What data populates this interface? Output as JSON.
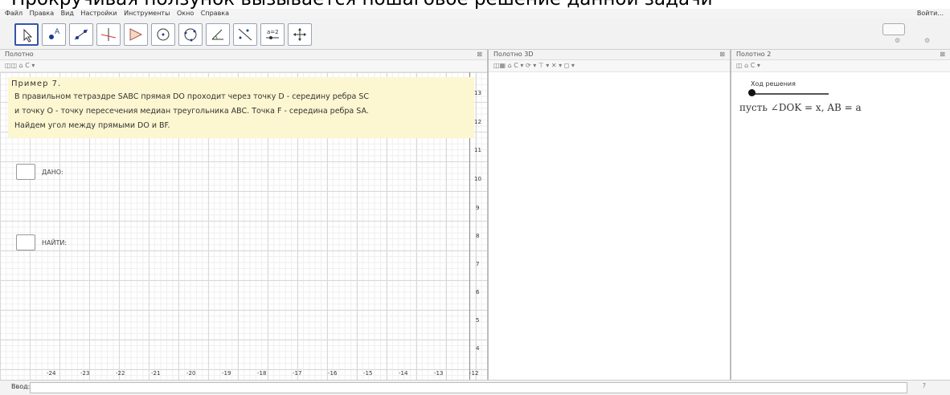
{
  "caption": "Прокручивая ползунок вызывается пошаговое решение данной задачи",
  "menu": {
    "items": [
      "Файл",
      "Правка",
      "Вид",
      "Настройки",
      "Инструменты",
      "Окно",
      "Справка"
    ],
    "login": "Войти..."
  },
  "panels": {
    "drawing": {
      "title": "Полотно"
    },
    "view3d": {
      "title": "Полотно 3D"
    },
    "drawing2": {
      "title": "Полотно 2"
    }
  },
  "textbox": {
    "title": "Пример 7.",
    "line1": "В правильном тетраэдре SABC прямая DO проходит через точку D - середину ребра SC",
    "line2": "и точку O - точку пересечения медиан треугольника ABC. Точка F - середина ребра SA.",
    "line3": "Найдем угол между прямыми DO и BF."
  },
  "checkboxes": {
    "given": "ДАНО:",
    "find": "НАЙТИ:"
  },
  "axes": {
    "x": [
      "-24",
      "-23",
      "-22",
      "-21",
      "-20",
      "-19",
      "-18",
      "-17",
      "-16",
      "-15",
      "-14",
      "-13",
      "-12"
    ],
    "y": [
      "13",
      "12",
      "11",
      "10",
      "9",
      "8",
      "7",
      "6",
      "5",
      "4"
    ]
  },
  "slider": {
    "label": "Ход решения",
    "value": 0
  },
  "formula": "пусть ∠DOK = x,  AB = a",
  "input": {
    "label": "Ввод:",
    "help": "?"
  }
}
